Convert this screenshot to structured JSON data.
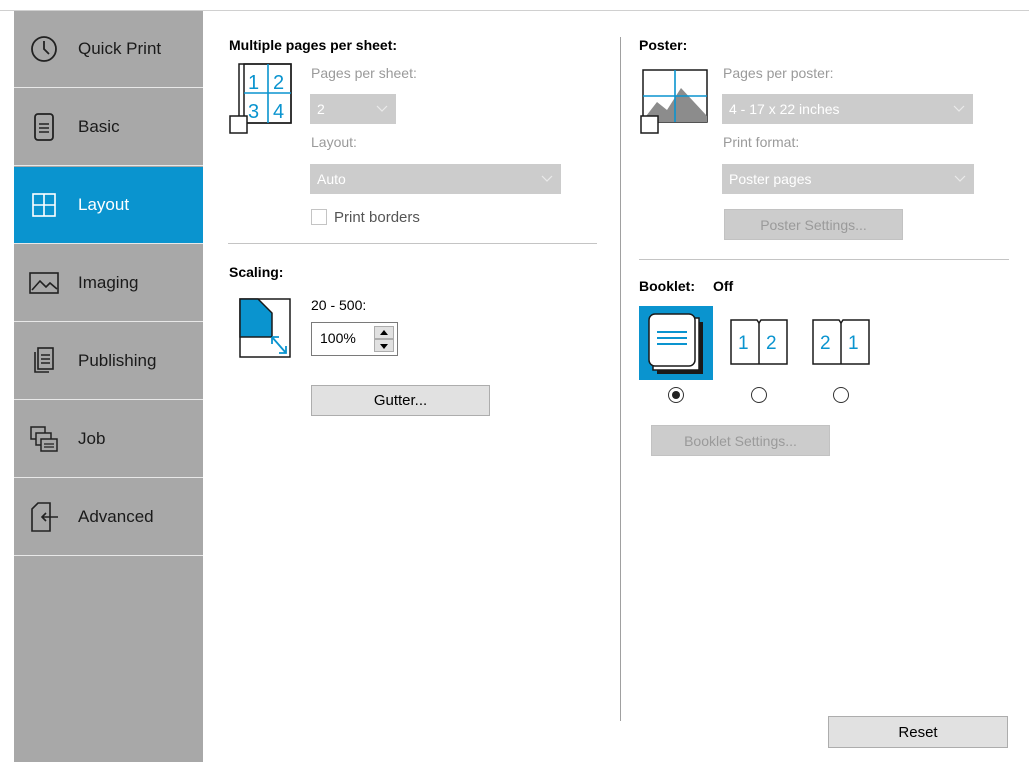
{
  "sidebar": {
    "items": [
      {
        "label": "Quick Print",
        "icon": "clock-icon",
        "active": false
      },
      {
        "label": "Basic",
        "icon": "document-icon",
        "active": false
      },
      {
        "label": "Layout",
        "icon": "layout-grid-icon",
        "active": true
      },
      {
        "label": "Imaging",
        "icon": "image-icon",
        "active": false
      },
      {
        "label": "Publishing",
        "icon": "publishing-icon",
        "active": false
      },
      {
        "label": "Job",
        "icon": "job-stack-icon",
        "active": false
      },
      {
        "label": "Advanced",
        "icon": "advanced-arrow-icon",
        "active": false
      }
    ]
  },
  "multiple_pages": {
    "title": "Multiple pages per sheet:",
    "pages_per_sheet_label": "Pages per sheet:",
    "pages_per_sheet_value": "2",
    "layout_label": "Layout:",
    "layout_value": "Auto",
    "print_borders_label": "Print borders",
    "print_borders_checked": false,
    "icon_digits": [
      "1",
      "2",
      "3",
      "4"
    ]
  },
  "scaling": {
    "title": "Scaling:",
    "range_label": "20 - 500:",
    "value": "100%",
    "gutter_button": "Gutter..."
  },
  "poster": {
    "title": "Poster:",
    "pages_per_poster_label": "Pages per poster:",
    "pages_per_poster_value": "4 - 17 x 22 inches",
    "print_format_label": "Print format:",
    "print_format_value": "Poster pages",
    "settings_button": "Poster Settings..."
  },
  "booklet": {
    "title": "Booklet:",
    "state": "Off",
    "options": [
      {
        "icon": "booklet-off-icon",
        "selected": true
      },
      {
        "icon": "booklet-left-binding-icon",
        "digits": [
          "1",
          "2"
        ],
        "selected": false
      },
      {
        "icon": "booklet-right-binding-icon",
        "digits": [
          "2",
          "1"
        ],
        "selected": false
      }
    ],
    "settings_button": "Booklet Settings..."
  },
  "footer": {
    "reset_button": "Reset"
  },
  "colors": {
    "accent": "#0a94cf",
    "sidebar_bg": "#a8a8a8",
    "disabled_bg": "#cccccc",
    "disabled_text": "#9a9a9a"
  }
}
